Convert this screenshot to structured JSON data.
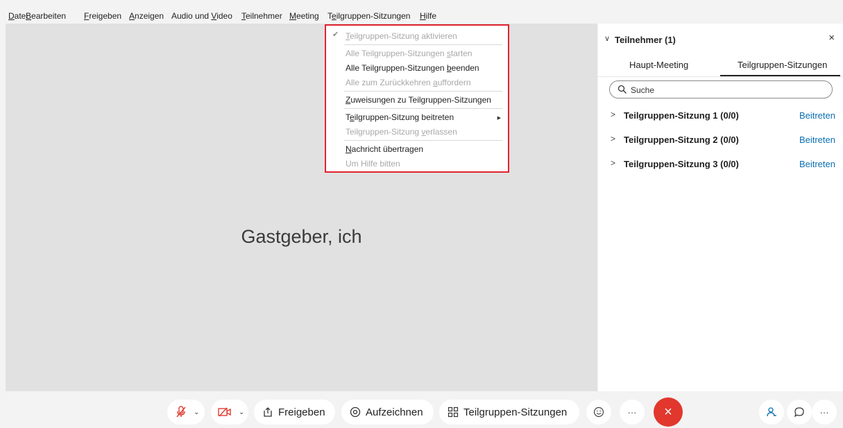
{
  "menubar": {
    "items": [
      {
        "pre": "",
        "u": "D",
        "post": "atei"
      },
      {
        "pre": "",
        "u": "B",
        "post": "earbeiten"
      },
      {
        "pre": "",
        "u": "F",
        "post": "reigeben"
      },
      {
        "pre": "",
        "u": "A",
        "post": "nzeigen"
      },
      {
        "pre": "Audio und ",
        "u": "V",
        "post": "ideo"
      },
      {
        "pre": "",
        "u": "T",
        "post": "eilnehmer"
      },
      {
        "pre": "",
        "u": "M",
        "post": "eeting"
      },
      {
        "pre": "T",
        "u": "e",
        "post": "ilgruppen-Sitzungen"
      },
      {
        "pre": "",
        "u": "H",
        "post": "ilfe"
      }
    ]
  },
  "stage": {
    "participant_name": "Gastgeber, ich"
  },
  "dropdown": {
    "items": [
      {
        "pre": "",
        "u": "T",
        "post": "eilgruppen-Sitzung aktivieren",
        "disabled": true
      },
      {
        "pre": "Alle Teilgruppen-Sitzungen ",
        "u": "s",
        "post": "tarten",
        "disabled": true
      },
      {
        "pre": "Alle Teilgruppen-Sitzungen ",
        "u": "b",
        "post": "eenden",
        "disabled": false
      },
      {
        "pre": "Alle zum Zurückkehren ",
        "u": "a",
        "post": "uffordern",
        "disabled": true
      },
      {
        "pre": "",
        "u": "Z",
        "post": "uweisungen zu Teilgruppen-Sitzungen",
        "disabled": false
      },
      {
        "pre": "T",
        "u": "e",
        "post": "ilgruppen-Sitzung beitreten",
        "disabled": false
      },
      {
        "pre": "Teilgruppen-Sitzung ",
        "u": "v",
        "post": "erlassen",
        "disabled": true
      },
      {
        "pre": "",
        "u": "N",
        "post": "achricht übertragen",
        "disabled": false
      },
      {
        "pre": "Um Hilfe bitten",
        "u": "",
        "post": "",
        "disabled": true
      }
    ]
  },
  "panel": {
    "title": "Teilnehmer (1)",
    "close": "×",
    "collapse": "∨",
    "tabs": [
      "Haupt-Meeting",
      "Teilgruppen-Sitzungen"
    ],
    "search_placeholder": "Suche",
    "sessions": [
      {
        "name": "Teilgruppen-Sitzung 1 (0/0)",
        "action": "Beitreten"
      },
      {
        "name": "Teilgruppen-Sitzung 2 (0/0)",
        "action": "Beitreten"
      },
      {
        "name": "Teilgruppen-Sitzung 3 (0/0)",
        "action": "Beitreten"
      }
    ]
  },
  "controls": {
    "share_label": "Freigeben",
    "record_label": "Aufzeichnen",
    "breakout_label": "Teilgruppen-Sitzungen",
    "more_label": "···",
    "end_label": "×"
  },
  "colors": {
    "menu_highlight_border": "#e0232e",
    "link": "#0a6fb3",
    "end_button": "#e2372c",
    "muted_icon": "#e03c31"
  }
}
